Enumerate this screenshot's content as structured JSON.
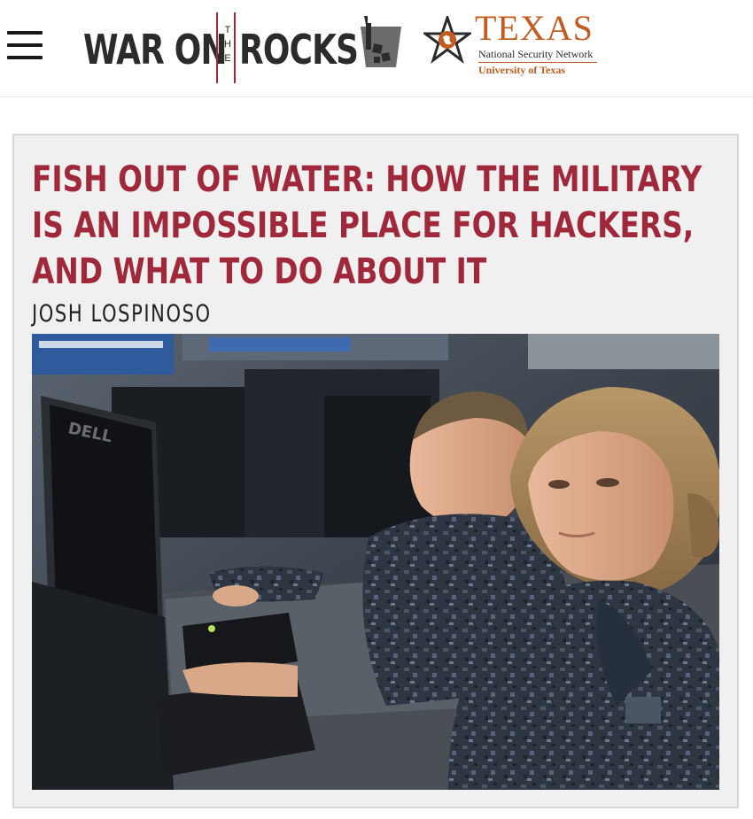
{
  "header": {
    "menu_icon": "hamburger-menu-icon",
    "site_logo": {
      "word_left": "WAR ON",
      "word_middle": [
        "T",
        "H",
        "E"
      ],
      "word_right": "ROCKS"
    },
    "partner_logo": {
      "name": "TEXAS",
      "subtitle": "National Security Network",
      "university": "University of Texas"
    }
  },
  "article": {
    "title": "FISH OUT OF WATER: HOW THE MILITARY IS AN IMPOSSIBLE PLACE FOR HACKERS, AND WHAT TO DO ABOUT IT",
    "author": "JOSH LOSPINOSO",
    "image_monitor_brand": "DELL"
  },
  "colors": {
    "accent": "#a0283b",
    "texas_orange": "#c35c20",
    "card_bg": "#f0f0f0",
    "card_border": "#d6d6d6"
  }
}
